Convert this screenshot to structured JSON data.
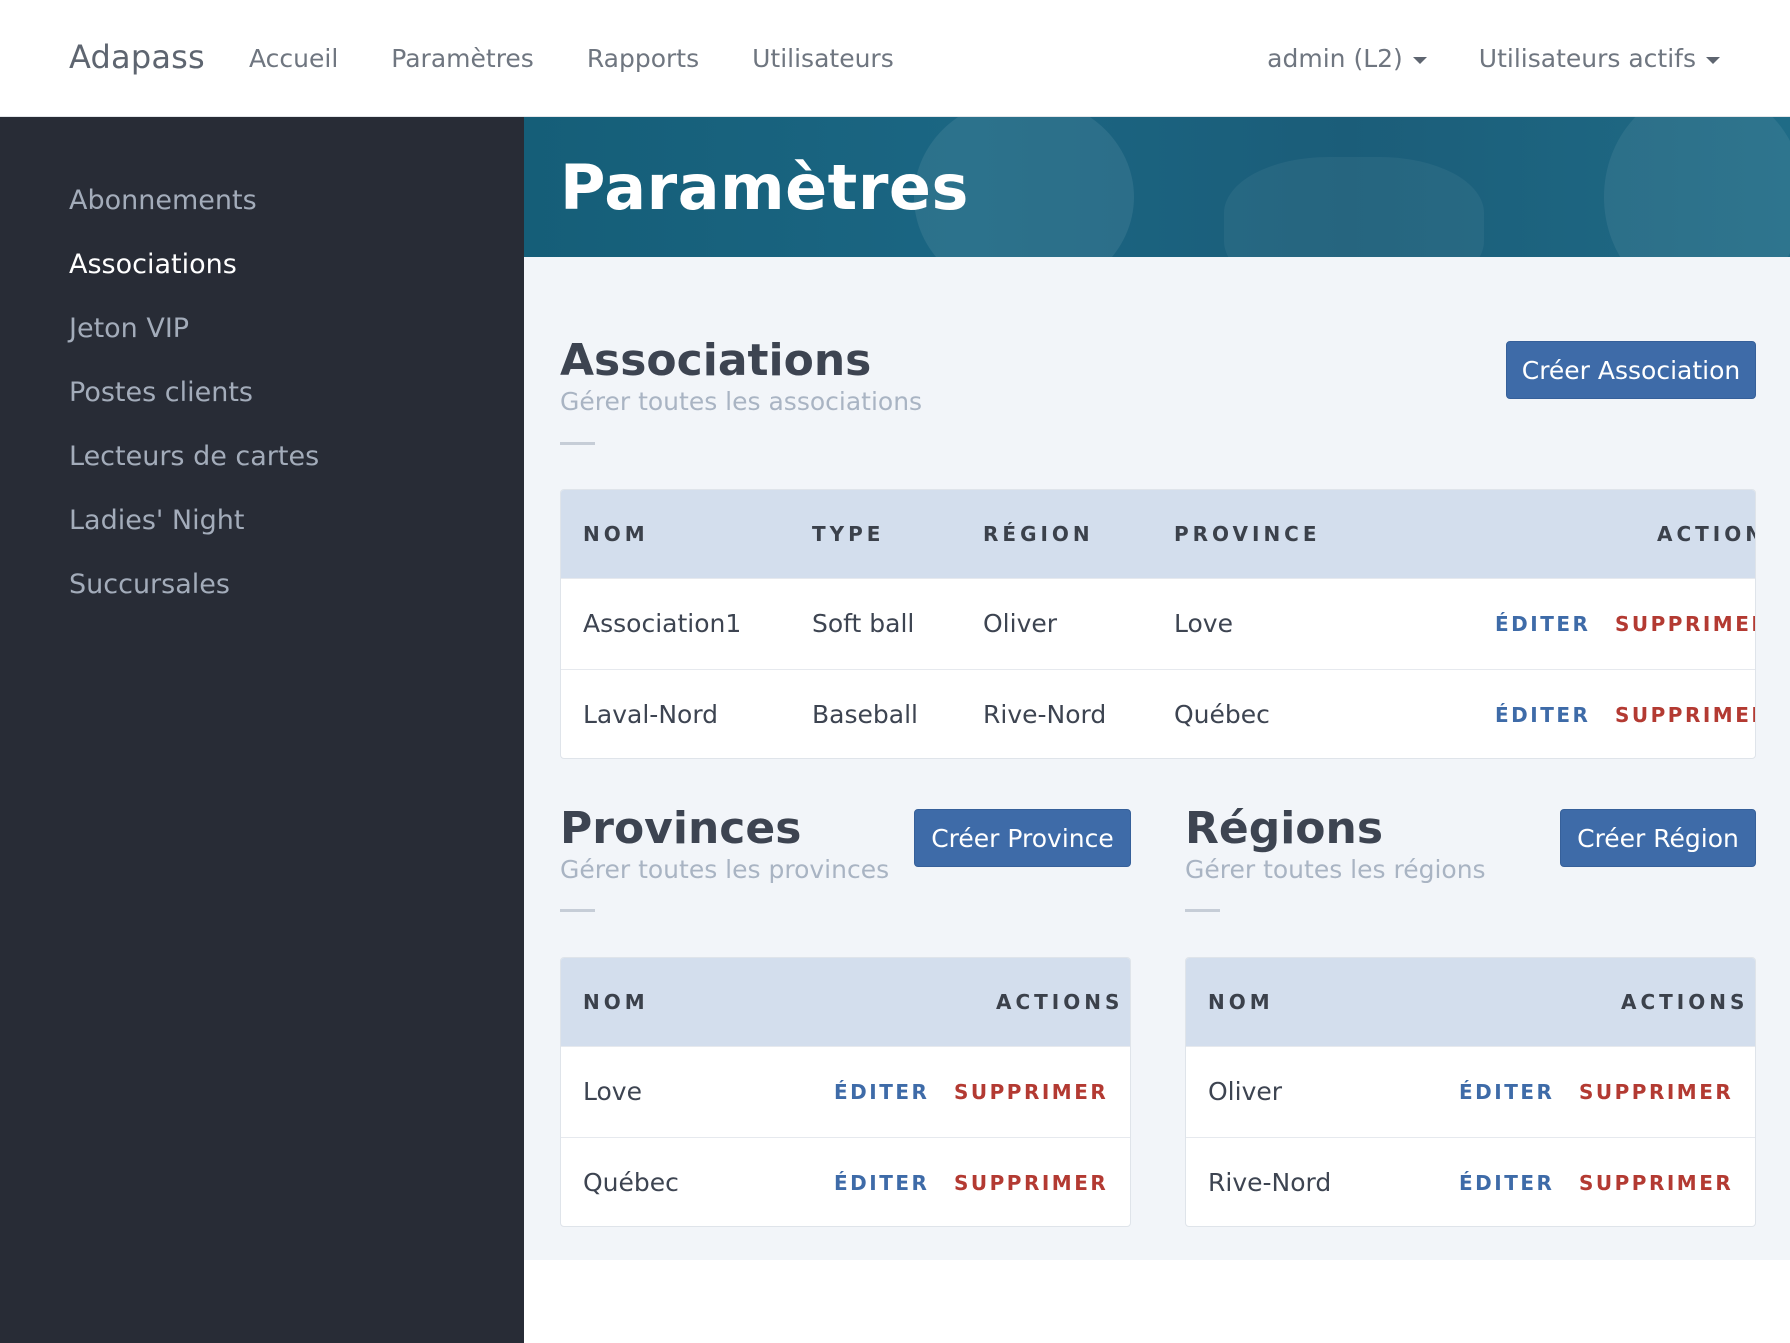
{
  "navbar": {
    "brand": "Adapass",
    "links": [
      "Accueil",
      "Paramètres",
      "Rapports",
      "Utilisateurs"
    ],
    "user_menu": "admin (L2)",
    "active_users_menu": "Utilisateurs actifs"
  },
  "sidebar": {
    "items": [
      {
        "label": "Abonnements"
      },
      {
        "label": "Associations"
      },
      {
        "label": "Jeton VIP"
      },
      {
        "label": "Postes clients"
      },
      {
        "label": "Lecteurs de cartes"
      },
      {
        "label": "Ladies' Night"
      },
      {
        "label": "Succursales"
      }
    ],
    "active_index": 1
  },
  "hero": {
    "title": "Paramètres"
  },
  "associations": {
    "title": "Associations",
    "subtitle": "Gérer toutes les associations",
    "create_label": "Créer Association",
    "headers": {
      "nom": "NOM",
      "type": "TYPE",
      "region": "RÉGION",
      "province": "PROVINCE",
      "actions": "ACTIONS"
    },
    "rows": [
      {
        "nom": "Association1",
        "type": "Soft ball",
        "region": "Oliver",
        "province": "Love"
      },
      {
        "nom": "Laval-Nord",
        "type": "Baseball",
        "region": "Rive-Nord",
        "province": "Québec"
      }
    ]
  },
  "provinces": {
    "title": "Provinces",
    "subtitle": "Gérer toutes les provinces",
    "create_label": "Créer Province",
    "headers": {
      "nom": "NOM",
      "actions": "ACTIONS"
    },
    "rows": [
      {
        "nom": "Love"
      },
      {
        "nom": "Québec"
      }
    ]
  },
  "regions": {
    "title": "Régions",
    "subtitle": "Gérer toutes les régions",
    "create_label": "Créer Région",
    "headers": {
      "nom": "NOM",
      "actions": "ACTIONS"
    },
    "rows": [
      {
        "nom": "Oliver"
      },
      {
        "nom": "Rive-Nord"
      }
    ]
  },
  "actions": {
    "edit": "ÉDITER",
    "delete": "SUPPRIMER"
  },
  "colors": {
    "primary": "#3e6ba8",
    "danger": "#b33a32",
    "sidebar_bg": "#282c36",
    "table_header_bg": "#d3deed",
    "hero_bg": "#1b6683"
  }
}
